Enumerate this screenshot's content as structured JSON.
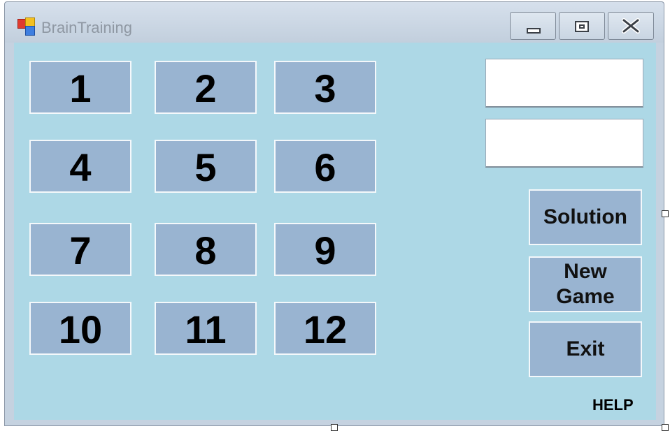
{
  "window": {
    "title": "BrainTraining",
    "icon": "app-icon",
    "controls": {
      "minimize_icon": "minimize-icon",
      "maximize_icon": "maximize-icon",
      "close_icon": "close-icon"
    }
  },
  "colors": {
    "client_background": "#add8e6",
    "button_background": "#99b4d1",
    "titlebar": "#c5d2e0"
  },
  "number_buttons": [
    "1",
    "2",
    "3",
    "4",
    "5",
    "6",
    "7",
    "8",
    "9",
    "10",
    "11",
    "12"
  ],
  "textboxes": [
    {
      "value": ""
    },
    {
      "value": ""
    }
  ],
  "side_buttons": {
    "solution": "Solution",
    "new_game_line1": "New",
    "new_game_line2": "Game",
    "exit": "Exit"
  },
  "help_label": "HELP"
}
